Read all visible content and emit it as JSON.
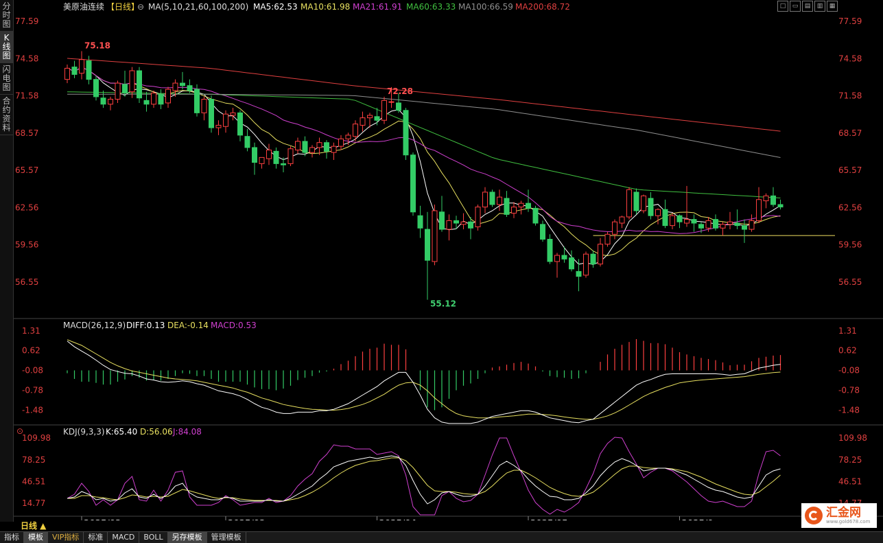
{
  "sidebar": {
    "tabs": [
      {
        "label": "分时图",
        "active": false
      },
      {
        "label": "K线图",
        "active": true
      },
      {
        "label": "闪电图",
        "active": false
      },
      {
        "label": "合约资料",
        "active": false
      }
    ]
  },
  "header": {
    "symbol": "美原油连续",
    "period_tag": "【日线】",
    "ma_spec": "MA(5,10,21,60,100,200)",
    "ma5": "MA5:62.53",
    "ma10": "MA10:61.98",
    "ma21": "MA21:61.91",
    "ma60": "MA60:63.33",
    "ma100": "MA100:66.59",
    "ma200": "MA200:68.72"
  },
  "window_controls": [
    "□",
    "▭",
    "▤",
    "▥",
    "▦"
  ],
  "colors": {
    "up": "#ff4040",
    "down": "#33cc66",
    "ma5": "#ffffff",
    "ma10": "#e8e060",
    "ma21": "#d040d0",
    "ma60": "#40c040",
    "ma100": "#909090",
    "ma200": "#e04040",
    "support": "#f0e060"
  },
  "chart_data": [
    {
      "type": "candlestick",
      "price_ticks": [
        "77.59",
        "74.58",
        "71.58",
        "68.57",
        "65.57",
        "62.56",
        "59.56",
        "56.55"
      ],
      "ylim": [
        53.6,
        78.2
      ],
      "annotations": [
        {
          "label": "75.18",
          "index": 2
        },
        {
          "label": "72.28",
          "index": 44
        },
        {
          "label": "55.12",
          "index": 50
        }
      ],
      "support_line": 60.3,
      "date_labels": [
        {
          "label": "2025/02",
          "index": 2
        },
        {
          "label": "2025/03",
          "index": 22
        },
        {
          "label": "2025/04",
          "index": 43
        },
        {
          "label": "2025/05",
          "index": 64
        },
        {
          "label": "2025/0",
          "index": 85
        }
      ],
      "candles": [
        [
          72.9,
          74.1,
          72.6,
          73.8
        ],
        [
          73.9,
          74.4,
          73.0,
          73.3
        ],
        [
          73.4,
          75.18,
          72.9,
          74.5
        ],
        [
          74.4,
          74.8,
          72.5,
          72.9
        ],
        [
          72.9,
          73.2,
          71.2,
          71.5
        ],
        [
          71.4,
          72.0,
          70.6,
          70.9
        ],
        [
          70.9,
          71.5,
          70.4,
          71.3
        ],
        [
          71.3,
          72.8,
          71.0,
          72.6
        ],
        [
          72.5,
          73.6,
          71.5,
          71.8
        ],
        [
          71.9,
          73.9,
          71.4,
          73.6
        ],
        [
          73.6,
          73.9,
          71.0,
          71.4
        ],
        [
          71.2,
          71.9,
          70.3,
          70.9
        ],
        [
          70.9,
          72.0,
          70.6,
          71.8
        ],
        [
          71.7,
          72.1,
          70.5,
          70.9
        ],
        [
          71.0,
          72.3,
          70.6,
          72.1
        ],
        [
          72.0,
          72.9,
          71.5,
          72.6
        ],
        [
          72.6,
          73.5,
          72.1,
          72.4
        ],
        [
          72.4,
          72.9,
          71.8,
          72.0
        ],
        [
          72.1,
          72.5,
          69.9,
          70.2
        ],
        [
          70.2,
          71.5,
          69.6,
          71.3
        ],
        [
          71.3,
          71.6,
          68.6,
          69.0
        ],
        [
          69.0,
          69.6,
          68.4,
          69.2
        ],
        [
          69.1,
          70.4,
          68.6,
          70.1
        ],
        [
          70.0,
          70.6,
          69.6,
          70.2
        ],
        [
          70.2,
          70.4,
          67.9,
          68.4
        ],
        [
          68.3,
          68.9,
          67.1,
          67.4
        ],
        [
          67.4,
          67.8,
          65.2,
          66.2
        ],
        [
          66.1,
          66.5,
          65.7,
          66.6
        ],
        [
          66.5,
          67.7,
          66.0,
          67.2
        ],
        [
          67.1,
          67.4,
          65.7,
          66.1
        ],
        [
          66.1,
          66.6,
          65.4,
          66.0
        ],
        [
          66.1,
          67.5,
          65.9,
          67.3
        ],
        [
          67.2,
          68.2,
          66.9,
          67.9
        ],
        [
          67.9,
          68.3,
          66.7,
          67.0
        ],
        [
          67.0,
          67.6,
          66.6,
          67.4
        ],
        [
          67.4,
          68.2,
          66.8,
          67.8
        ],
        [
          67.8,
          68.0,
          66.5,
          67.1
        ],
        [
          67.0,
          67.8,
          66.4,
          67.5
        ],
        [
          67.5,
          68.4,
          67.2,
          68.1
        ],
        [
          68.1,
          68.6,
          67.6,
          68.4
        ],
        [
          68.3,
          69.6,
          67.9,
          69.3
        ],
        [
          69.2,
          70.3,
          68.7,
          69.8
        ],
        [
          69.8,
          70.2,
          69.0,
          70.0
        ],
        [
          69.9,
          70.6,
          69.2,
          69.6
        ],
        [
          69.6,
          71.5,
          69.3,
          71.2
        ],
        [
          71.1,
          72.28,
          70.6,
          71.1
        ],
        [
          71.0,
          71.8,
          70.2,
          70.4
        ],
        [
          70.4,
          70.6,
          66.4,
          66.8
        ],
        [
          66.8,
          67.0,
          61.9,
          62.2
        ],
        [
          61.9,
          62.7,
          60.1,
          60.9
        ],
        [
          60.8,
          62.2,
          55.12,
          58.3
        ],
        [
          58.2,
          62.8,
          57.9,
          62.3
        ],
        [
          62.2,
          63.5,
          60.6,
          60.8
        ],
        [
          60.8,
          62.0,
          59.9,
          61.5
        ],
        [
          61.5,
          61.9,
          60.8,
          61.3
        ],
        [
          61.2,
          62.1,
          60.8,
          61.4
        ],
        [
          61.4,
          61.8,
          60.0,
          60.9
        ],
        [
          61.0,
          62.8,
          60.7,
          62.6
        ],
        [
          62.6,
          64.2,
          62.1,
          63.8
        ],
        [
          63.8,
          64.0,
          62.6,
          62.8
        ],
        [
          62.8,
          64.0,
          62.3,
          63.4
        ],
        [
          63.3,
          63.9,
          61.8,
          62.0
        ],
        [
          62.1,
          63.0,
          61.7,
          62.6
        ],
        [
          62.6,
          63.1,
          62.0,
          62.9
        ],
        [
          62.9,
          64.0,
          62.2,
          62.5
        ],
        [
          62.5,
          62.7,
          61.1,
          61.3
        ],
        [
          61.2,
          61.5,
          59.8,
          60.0
        ],
        [
          60.0,
          60.4,
          58.0,
          58.2
        ],
        [
          58.2,
          58.9,
          56.9,
          58.7
        ],
        [
          58.7,
          59.4,
          58.1,
          58.4
        ],
        [
          58.5,
          59.1,
          57.4,
          57.6
        ],
        [
          57.4,
          58.4,
          55.8,
          57.0
        ],
        [
          57.1,
          59.0,
          56.9,
          58.8
        ],
        [
          58.8,
          59.1,
          57.7,
          58.0
        ],
        [
          58.0,
          60.1,
          57.8,
          59.6
        ],
        [
          59.6,
          60.6,
          59.4,
          60.4
        ],
        [
          60.4,
          61.6,
          60.0,
          61.4
        ],
        [
          61.3,
          61.9,
          60.9,
          61.8
        ],
        [
          61.8,
          64.2,
          61.6,
          64.0
        ],
        [
          63.8,
          64.1,
          62.0,
          62.3
        ],
        [
          62.3,
          63.6,
          62.1,
          63.5
        ],
        [
          63.3,
          63.8,
          61.6,
          61.9
        ],
        [
          61.9,
          62.5,
          61.2,
          62.4
        ],
        [
          62.4,
          63.2,
          60.9,
          61.1
        ],
        [
          61.1,
          62.1,
          60.8,
          61.9
        ],
        [
          61.9,
          62.0,
          60.9,
          61.4
        ],
        [
          61.3,
          64.3,
          61.0,
          61.6
        ],
        [
          61.6,
          62.0,
          60.6,
          61.3
        ],
        [
          61.2,
          61.4,
          60.5,
          60.9
        ],
        [
          60.9,
          61.8,
          60.6,
          61.5
        ],
        [
          61.6,
          62.0,
          60.7,
          60.9
        ],
        [
          60.9,
          61.4,
          60.3,
          61.2
        ],
        [
          61.2,
          62.2,
          60.8,
          61.4
        ],
        [
          61.3,
          62.4,
          60.8,
          61.1
        ],
        [
          61.1,
          61.6,
          59.7,
          60.8
        ],
        [
          60.8,
          62.0,
          60.6,
          61.5
        ],
        [
          61.5,
          64.2,
          61.3,
          63.2
        ],
        [
          63.1,
          63.7,
          62.5,
          63.5
        ],
        [
          63.5,
          64.2,
          62.6,
          62.8
        ],
        [
          62.8,
          63.2,
          62.4,
          62.6
        ]
      ]
    },
    {
      "type": "macd",
      "title": "MACD(26,12,9)",
      "diff_label": "DIFF:0.13",
      "dea_label": "DEA:-0.14",
      "macd_label": "MACD:0.53",
      "ticks": [
        "1.31",
        "0.62",
        "-0.08",
        "-0.78",
        "-1.48"
      ],
      "ylim": [
        -2.0,
        1.6
      ],
      "diff": [
        0.95,
        0.75,
        0.6,
        0.45,
        0.28,
        0.1,
        -0.05,
        -0.12,
        -0.18,
        -0.2,
        -0.28,
        -0.38,
        -0.42,
        -0.48,
        -0.5,
        -0.48,
        -0.45,
        -0.48,
        -0.55,
        -0.6,
        -0.7,
        -0.8,
        -0.85,
        -0.9,
        -0.98,
        -1.1,
        -1.25,
        -1.38,
        -1.45,
        -1.55,
        -1.6,
        -1.6,
        -1.55,
        -1.55,
        -1.55,
        -1.5,
        -1.5,
        -1.45,
        -1.35,
        -1.25,
        -1.1,
        -0.95,
        -0.8,
        -0.65,
        -0.45,
        -0.3,
        -0.15,
        -0.15,
        -0.5,
        -0.95,
        -1.45,
        -1.75,
        -1.9,
        -1.95,
        -1.95,
        -1.95,
        -1.95,
        -1.9,
        -1.8,
        -1.7,
        -1.65,
        -1.6,
        -1.55,
        -1.5,
        -1.5,
        -1.55,
        -1.65,
        -1.75,
        -1.8,
        -1.85,
        -1.9,
        -1.92,
        -1.85,
        -1.8,
        -1.6,
        -1.4,
        -1.2,
        -1.0,
        -0.8,
        -0.6,
        -0.48,
        -0.4,
        -0.3,
        -0.22,
        -0.2,
        -0.2,
        -0.2,
        -0.2,
        -0.2,
        -0.2,
        -0.2,
        -0.22,
        -0.25,
        -0.22,
        -0.2,
        -0.1,
        0.0,
        0.05,
        0.1,
        0.13
      ],
      "dea": [
        1.0,
        0.9,
        0.8,
        0.65,
        0.5,
        0.35,
        0.2,
        0.08,
        -0.02,
        -0.1,
        -0.15,
        -0.2,
        -0.25,
        -0.3,
        -0.35,
        -0.38,
        -0.4,
        -0.42,
        -0.45,
        -0.5,
        -0.55,
        -0.6,
        -0.65,
        -0.7,
        -0.78,
        -0.85,
        -0.95,
        -1.05,
        -1.12,
        -1.2,
        -1.28,
        -1.33,
        -1.38,
        -1.42,
        -1.45,
        -1.46,
        -1.48,
        -1.48,
        -1.46,
        -1.42,
        -1.35,
        -1.28,
        -1.18,
        -1.05,
        -0.92,
        -0.75,
        -0.6,
        -0.52,
        -0.5,
        -0.6,
        -0.8,
        -1.05,
        -1.25,
        -1.45,
        -1.6,
        -1.68,
        -1.72,
        -1.75,
        -1.75,
        -1.75,
        -1.72,
        -1.7,
        -1.68,
        -1.65,
        -1.62,
        -1.62,
        -1.63,
        -1.65,
        -1.68,
        -1.72,
        -1.75,
        -1.78,
        -1.8,
        -1.8,
        -1.75,
        -1.68,
        -1.58,
        -1.45,
        -1.3,
        -1.15,
        -1.0,
        -0.88,
        -0.78,
        -0.68,
        -0.6,
        -0.52,
        -0.48,
        -0.45,
        -0.42,
        -0.4,
        -0.38,
        -0.36,
        -0.34,
        -0.32,
        -0.3,
        -0.26,
        -0.22,
        -0.19,
        -0.16,
        -0.14
      ]
    },
    {
      "type": "kdj",
      "title": "KDJ(9,3,3)",
      "k_label": "K:65.40",
      "d_label": "D:56.06",
      "j_label": "J:84.08",
      "ticks": [
        "109.98",
        "78.25",
        "46.51",
        "14.77"
      ],
      "ylim": [
        0,
        118
      ],
      "k": [
        22,
        24,
        32,
        28,
        20,
        22,
        18,
        20,
        30,
        36,
        24,
        22,
        28,
        22,
        28,
        40,
        44,
        30,
        24,
        22,
        20,
        20,
        24,
        22,
        18,
        18,
        18,
        18,
        20,
        18,
        18,
        22,
        28,
        34,
        40,
        50,
        58,
        68,
        72,
        76,
        78,
        80,
        82,
        80,
        82,
        84,
        82,
        70,
        48,
        28,
        14,
        20,
        30,
        32,
        28,
        25,
        25,
        28,
        40,
        55,
        70,
        76,
        70,
        62,
        50,
        40,
        32,
        25,
        24,
        20,
        20,
        22,
        30,
        40,
        55,
        66,
        75,
        80,
        76,
        70,
        62,
        64,
        66,
        66,
        64,
        60,
        56,
        50,
        44,
        38,
        34,
        32,
        28,
        24,
        22,
        24,
        40,
        56,
        62,
        65
      ],
      "d": [
        22,
        22,
        26,
        26,
        24,
        23,
        21,
        20,
        23,
        27,
        26,
        24,
        25,
        24,
        25,
        30,
        35,
        33,
        30,
        27,
        24,
        22,
        23,
        23,
        21,
        20,
        19,
        19,
        19,
        19,
        18,
        20,
        22,
        26,
        31,
        37,
        44,
        52,
        59,
        65,
        70,
        73,
        76,
        77,
        79,
        81,
        81,
        77,
        67,
        54,
        41,
        33,
        32,
        32,
        31,
        29,
        28,
        28,
        32,
        40,
        50,
        59,
        63,
        63,
        58,
        52,
        45,
        38,
        33,
        29,
        26,
        25,
        27,
        31,
        39,
        48,
        57,
        65,
        69,
        69,
        67,
        66,
        66,
        66,
        65,
        63,
        61,
        57,
        53,
        48,
        43,
        39,
        35,
        31,
        28,
        27,
        31,
        39,
        47,
        56
      ],
      "j": [
        22,
        28,
        44,
        32,
        12,
        20,
        12,
        20,
        44,
        54,
        20,
        18,
        34,
        18,
        34,
        60,
        62,
        24,
        12,
        12,
        12,
        16,
        26,
        20,
        12,
        14,
        16,
        16,
        22,
        16,
        18,
        26,
        40,
        50,
        58,
        76,
        86,
        100,
        98,
        98,
        94,
        94,
        94,
        86,
        88,
        90,
        84,
        56,
        10,
        -24,
        -40,
        -6,
        26,
        32,
        22,
        17,
        19,
        28,
        56,
        85,
        110,
        110,
        84,
        60,
        34,
        16,
        6,
        -1,
        6,
        2,
        8,
        16,
        36,
        58,
        87,
        102,
        111,
        110,
        90,
        72,
        52,
        60,
        66,
        66,
        62,
        54,
        46,
        36,
        26,
        18,
        16,
        18,
        14,
        10,
        10,
        18,
        58,
        90,
        92,
        84
      ]
    }
  ],
  "footer": {
    "period": "日线 ▲",
    "tabs": [
      {
        "label": "指标",
        "active": false,
        "vip": false
      },
      {
        "label": "模板",
        "active": true,
        "vip": false
      },
      {
        "label": "VIP指标",
        "active": false,
        "vip": true
      },
      {
        "label": "标准",
        "active": false,
        "vip": false
      },
      {
        "label": "MACD",
        "active": false,
        "vip": false
      },
      {
        "label": "BOLL",
        "active": false,
        "vip": false
      },
      {
        "label": "另存模板",
        "active": true,
        "vip": false
      },
      {
        "label": "管理模板",
        "active": false,
        "vip": false
      }
    ]
  },
  "logo": {
    "name": "汇金网",
    "url": "www.gold678.com"
  }
}
